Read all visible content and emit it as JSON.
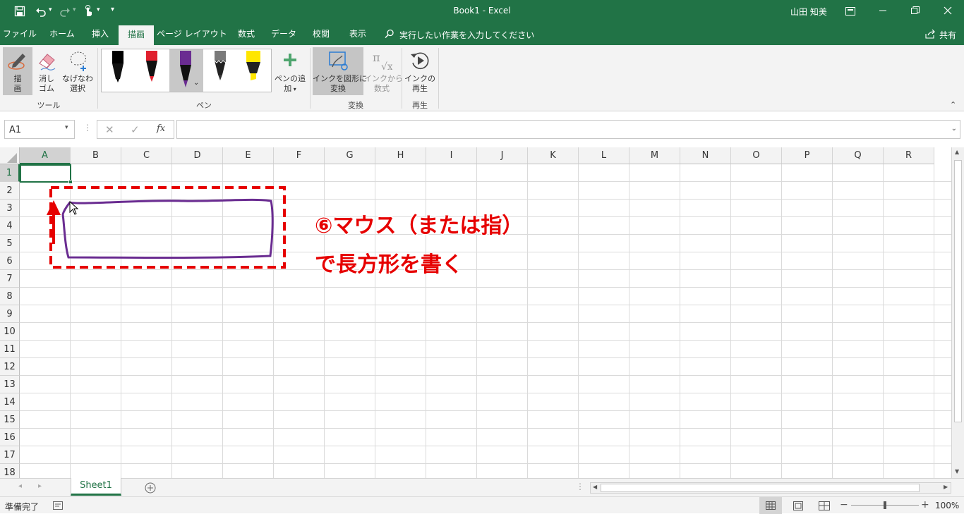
{
  "title_bar": {
    "title": "Book1  -  Excel",
    "user": "山田 知美",
    "qat_customize": "▾"
  },
  "tabs": [
    "ファイル",
    "ホーム",
    "挿入",
    "描画",
    "ページ レイアウト",
    "数式",
    "データ",
    "校閲",
    "表示"
  ],
  "active_tab": "描画",
  "tell_me": "実行したい作業を入力してください",
  "share": "共有",
  "ribbon": {
    "tools": {
      "draw_line1": "描",
      "draw_line2": "画",
      "eraser_line1": "消し",
      "eraser_line2": "ゴム",
      "lasso_line1": "なげなわ",
      "lasso_line2": "選択",
      "group": "ツール"
    },
    "pens": {
      "add_line1": "ペンの追",
      "add_line2": "加",
      "group": "ペン",
      "colors": [
        "#000000",
        "#e0202e",
        "#6a2c91",
        "#7a7a7a",
        "#ffe600"
      ]
    },
    "convert": {
      "ink_to_shape_line1": "インクを図形に",
      "ink_to_shape_line2": "変換",
      "ink_to_math_line1": "インクから",
      "ink_to_math_line2": "数式",
      "group": "変換"
    },
    "replay": {
      "btn_line1": "インクの",
      "btn_line2": "再生",
      "group": "再生"
    }
  },
  "formula_bar": {
    "name_box": "A1",
    "fx": "fx",
    "value": ""
  },
  "columns": [
    "A",
    "B",
    "C",
    "D",
    "E",
    "F",
    "G",
    "H",
    "I",
    "J",
    "K",
    "L",
    "M",
    "N",
    "O",
    "P",
    "Q",
    "R"
  ],
  "rows": [
    "1",
    "2",
    "3",
    "4",
    "5",
    "6",
    "7",
    "8",
    "9",
    "10",
    "11",
    "12",
    "13",
    "14",
    "15",
    "16",
    "17",
    "18"
  ],
  "selected_cell": "A1",
  "annotation": {
    "line1": "⑥マウス（または指）",
    "line2": "で長方形を書く",
    "color": "#e60000"
  },
  "ink_color": "#6a2c91",
  "sheets": [
    "Sheet1"
  ],
  "status": {
    "ready": "準備完了",
    "zoom": "100%",
    "zoom_level": 100
  },
  "colors": {
    "excel_green": "#217346",
    "annotation_red": "#e60000"
  }
}
